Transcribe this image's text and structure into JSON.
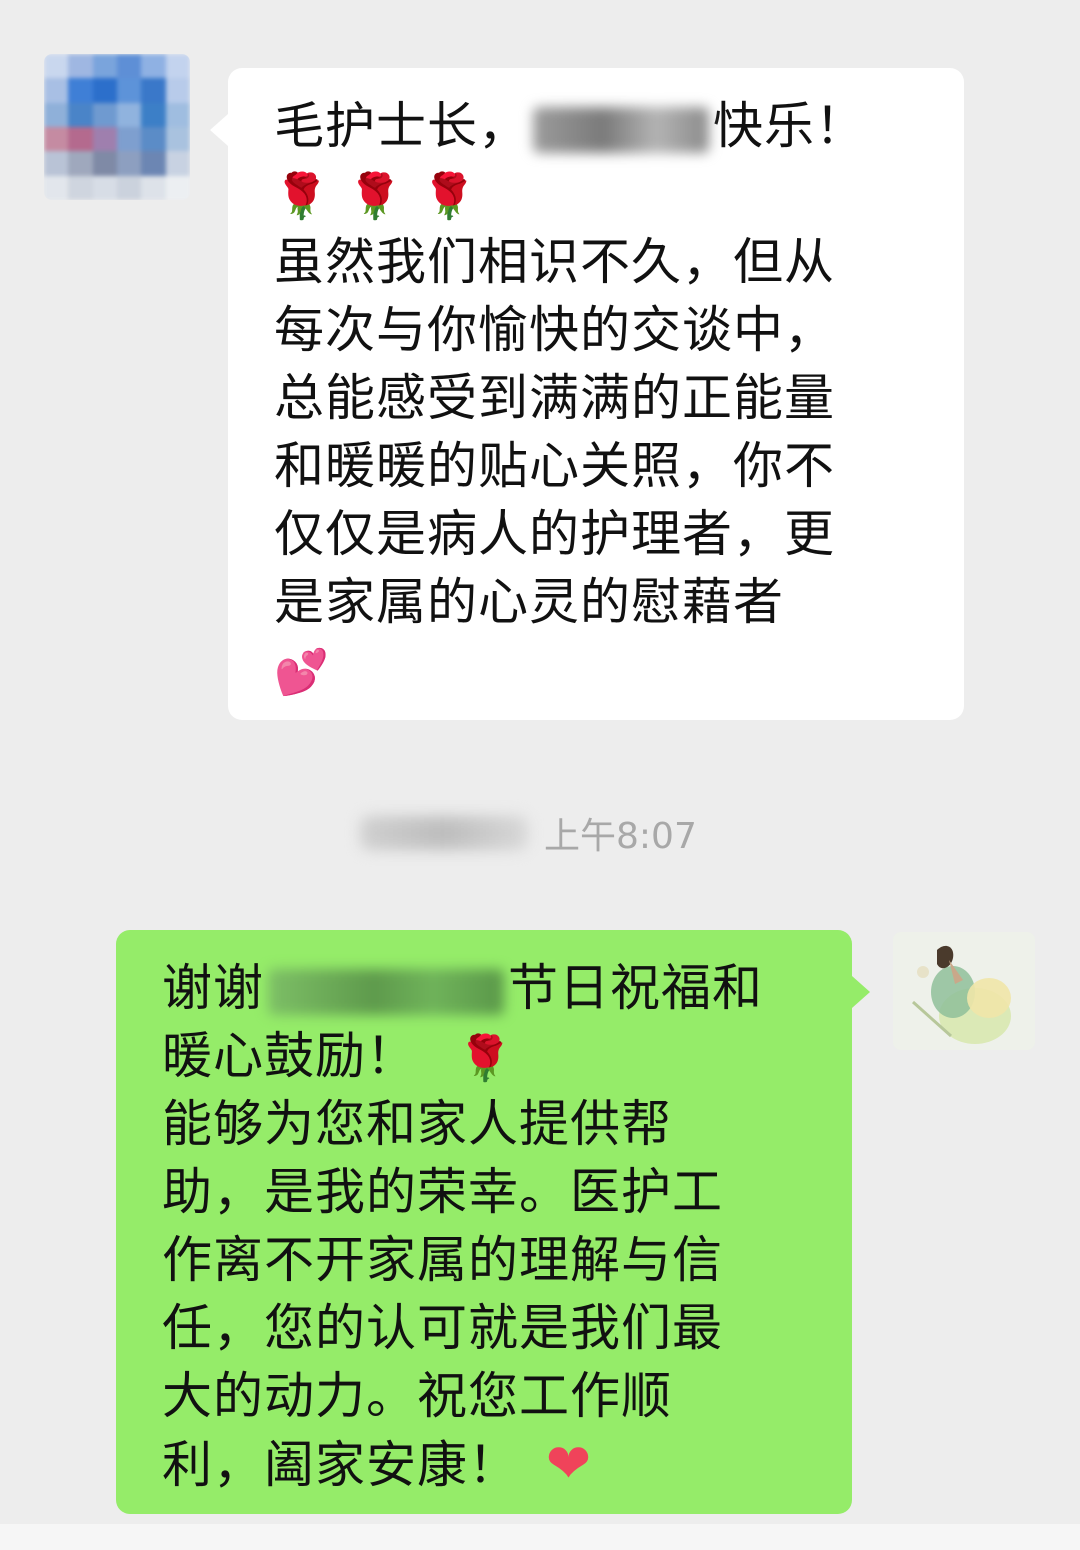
{
  "incoming_message": {
    "lines": [
      {
        "before": "毛护士长，",
        "after": "快乐！"
      },
      "虽然我们相识不久，但从",
      "每次与你愉快的交谈中，",
      "总能感受到满满的正能量",
      "和暖暖的贴心关照，你不",
      "仅仅是病人的护理者，更",
      "是家属的心灵的慰藉者"
    ],
    "rose_emojis": [
      "🌹",
      "🌹",
      "🌹"
    ],
    "hearts_emoji": "💕"
  },
  "timestamp": {
    "time": "上午8:07"
  },
  "outgoing_message": {
    "lines": [
      {
        "before": "谢谢",
        "after": "节日祝福和"
      },
      {
        "text": "暖心鼓励！",
        "emoji": "🌹"
      },
      "能够为您和家人提供帮",
      "助，是我的荣幸。医护工",
      "作离不开家属的理解与信",
      "任，您的认可就是我们最",
      "大的动力。祝您工作顺",
      {
        "text": "利，阖家安康！",
        "emoji": "❤"
      }
    ]
  },
  "colors": {
    "background": "#ededed",
    "incoming_bubble": "#ffffff",
    "outgoing_bubble": "#95ec69",
    "timestamp_text": "#a8a8a8"
  }
}
